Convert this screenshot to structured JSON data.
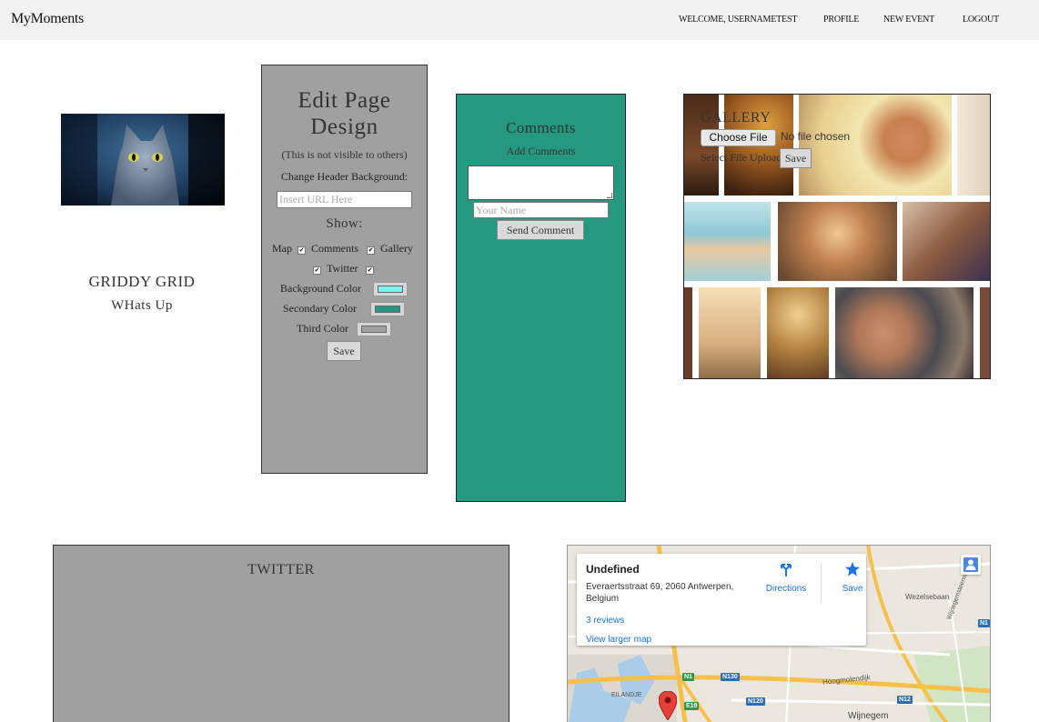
{
  "nav": {
    "brand": "MyMoments",
    "links": [
      "WELCOME, USERNAMETEST",
      "PROFILE",
      "NEW EVENT",
      "LOGOUT"
    ]
  },
  "profile": {
    "name": "GRIDDY GRID",
    "subtitle": "WHats Up"
  },
  "edit": {
    "title_line1": "Edit Page",
    "title_line2": "Design",
    "note": "(This is not visible to others)",
    "header_bg_label": "Change Header Background:",
    "url_placeholder": "Insert URL Here",
    "show_label": "Show:",
    "options": [
      "Map",
      "Comments",
      "Gallery",
      "Twitter"
    ],
    "colors": [
      {
        "label": "Background Color",
        "value": "#7ff2f0"
      },
      {
        "label": "Secondary Color",
        "value": "#24997f"
      },
      {
        "label": "Third Color",
        "value": "#a0a0a0"
      }
    ],
    "save_label": "Save"
  },
  "comments": {
    "title": "Comments",
    "subtitle": "Add Comments",
    "name_placeholder": "Your Name",
    "send_label": "Send Comment"
  },
  "gallery": {
    "title": "GALLERY",
    "choose_label": "Choose File",
    "no_file": "No file chosen",
    "upload_label": "Select File Upload",
    "save_label": "Save"
  },
  "twitter": {
    "title": "TWITTER"
  },
  "map": {
    "place_name": "Undefined",
    "address": "Everaertsstraat 69, 2060 Antwerpen, Belgium",
    "reviews": "3 reviews",
    "larger_map": "View larger map",
    "directions": "Directions",
    "save": "Save",
    "road_labels": [
      "N1",
      "N130",
      "E19",
      "N120",
      "N12",
      "N1"
    ],
    "place_labels": [
      "Wezelsebaan",
      "Wijnegem",
      "Hoogmolendijk",
      "EILANDJE",
      "Wijnegemsteenweg"
    ]
  },
  "colors": {
    "navbar": "#f2f2f2",
    "panel_grey": "#a0a0a0",
    "panel_teal": "#24997f",
    "link_blue": "#1a73e8"
  }
}
